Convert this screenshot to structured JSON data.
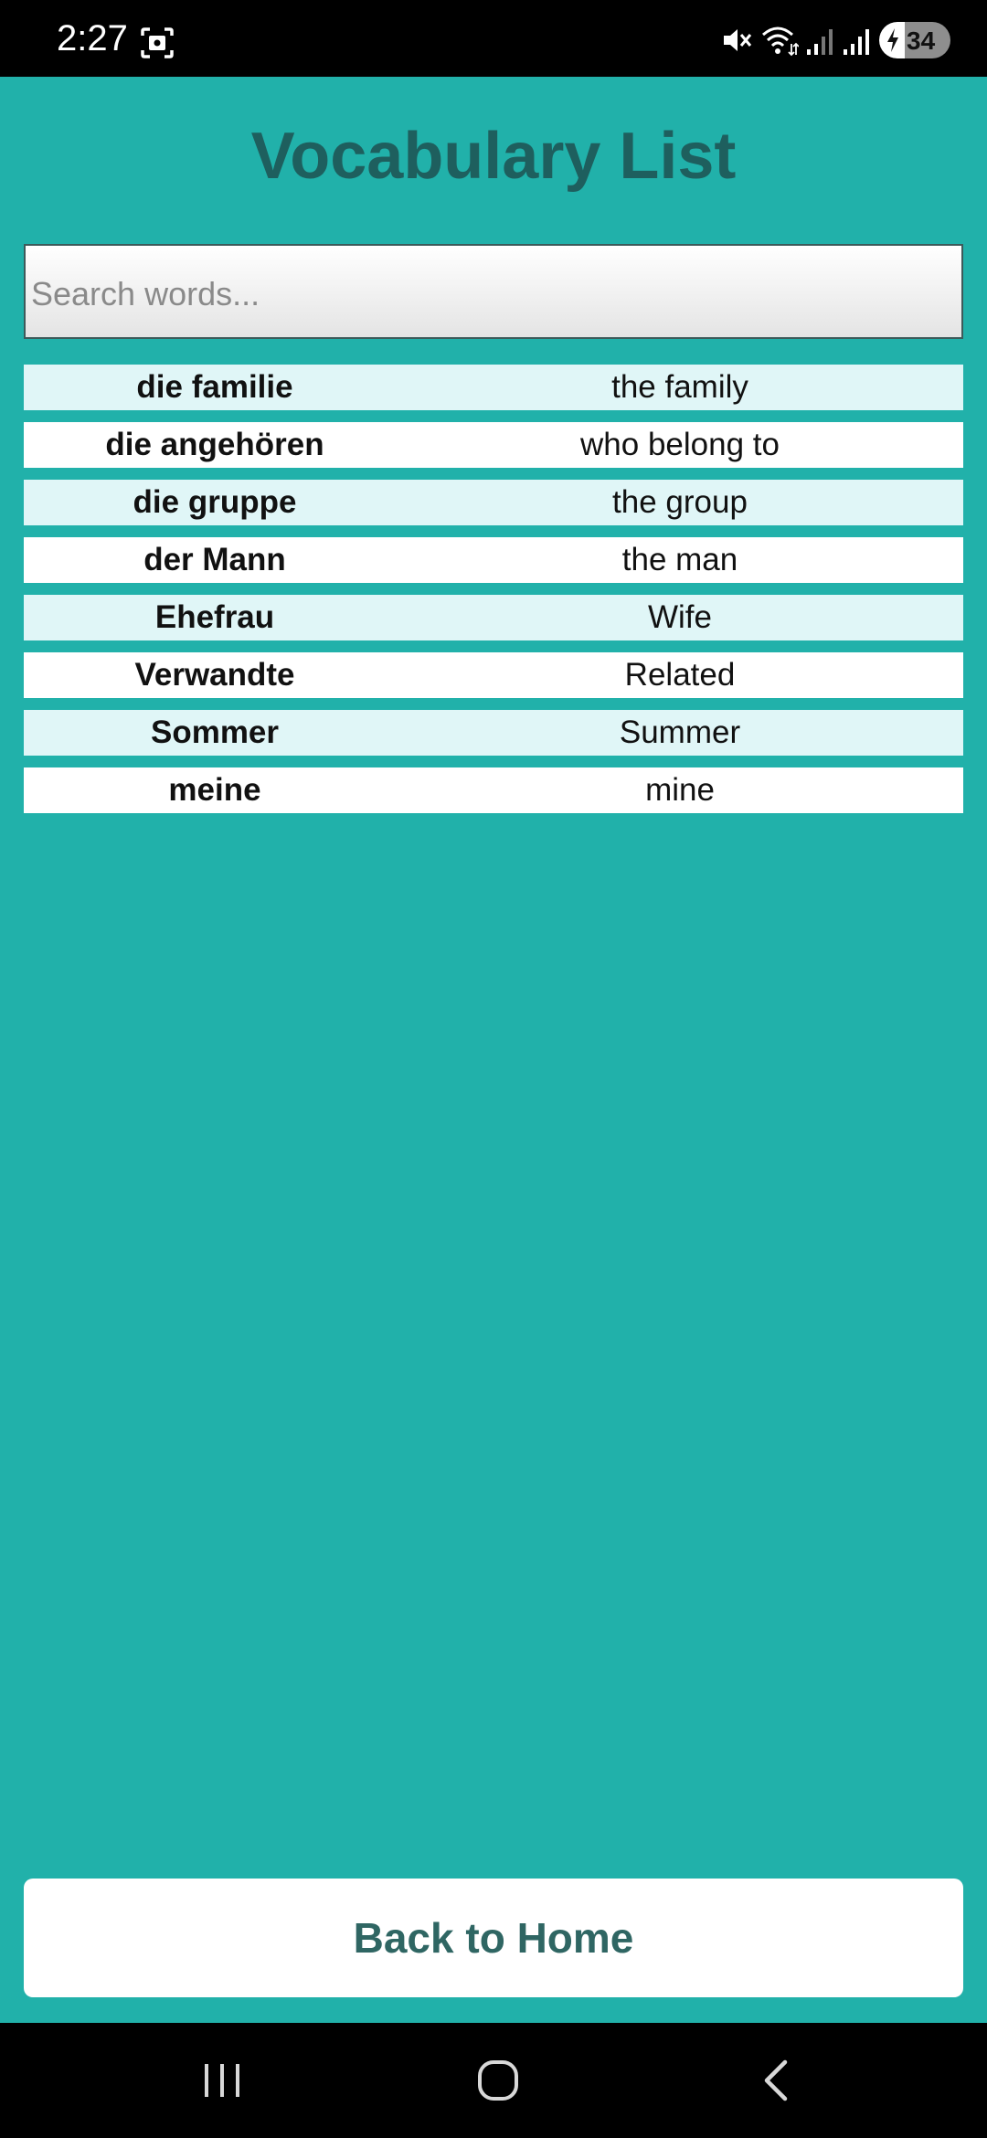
{
  "status_bar": {
    "time": "2:27",
    "battery_level": "34",
    "icons": [
      "screenshot-icon",
      "mute-icon",
      "wifi-icon",
      "signal-icon",
      "signal-icon",
      "battery-charging-icon"
    ]
  },
  "page": {
    "title": "Vocabulary List"
  },
  "search": {
    "placeholder": "Search words...",
    "value": ""
  },
  "vocabulary": [
    {
      "word": "die familie",
      "translation": "the family"
    },
    {
      "word": "die angehören",
      "translation": "who belong to"
    },
    {
      "word": "die gruppe",
      "translation": "the group"
    },
    {
      "word": "der Mann",
      "translation": "the man"
    },
    {
      "word": "Ehefrau",
      "translation": "Wife"
    },
    {
      "word": "Verwandte",
      "translation": "Related"
    },
    {
      "word": "Sommer",
      "translation": "Summer"
    },
    {
      "word": "meine",
      "translation": "mine"
    }
  ],
  "actions": {
    "back_label": "Back to Home"
  },
  "colors": {
    "background": "#21b1aa",
    "title": "#1e5f5e",
    "row_alt": "#e0f6f7",
    "button_text": "#2f6663"
  },
  "nav_bar": {
    "icons": [
      "recent-apps-icon",
      "home-icon",
      "back-icon"
    ]
  }
}
